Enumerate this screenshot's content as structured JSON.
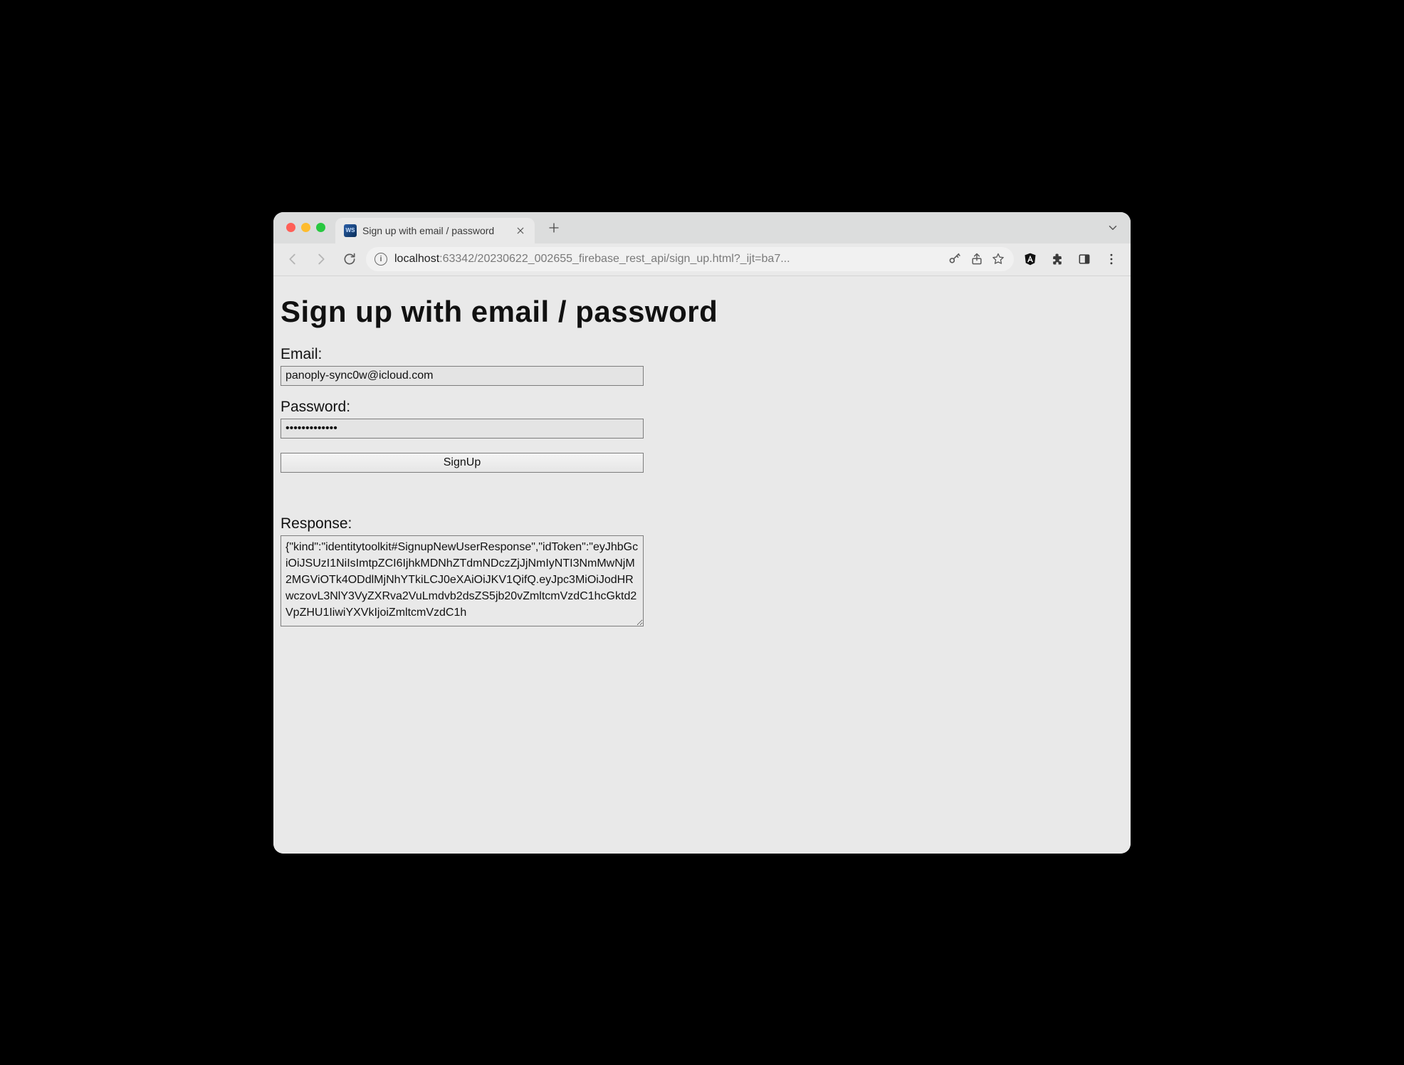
{
  "browser": {
    "tab_title": "Sign up with email / password",
    "url_host": "localhost",
    "url_rest": ":63342/20230622_002655_firebase_rest_api/sign_up.html?_ijt=ba7..."
  },
  "page": {
    "heading": "Sign up with email / password",
    "email_label": "Email:",
    "email_value": "panoply-sync0w@icloud.com",
    "password_label": "Password:",
    "password_value": "•••••••••••••",
    "signup_label": "SignUp",
    "response_label": "Response:",
    "response_value": "{\"kind\":\"identitytoolkit#SignupNewUserResponse\",\"idToken\":\"eyJhbGciOiJSUzI1NiIsImtpZCI6IjhkMDNhZTdmNDczZjJjNmIyNTI3NmMwNjM2MGViOTk4ODdlMjNhYTkiLCJ0eXAiOiJKV1QifQ.eyJpc3MiOiJodHRwczovL3NlY3VyZXRva2VuLmdvb2dsZS5jb20vZmltcmVzdC1hcGktd2VpZHU1IiwiYXVkIjoiZmltcmVzdC1h"
  }
}
